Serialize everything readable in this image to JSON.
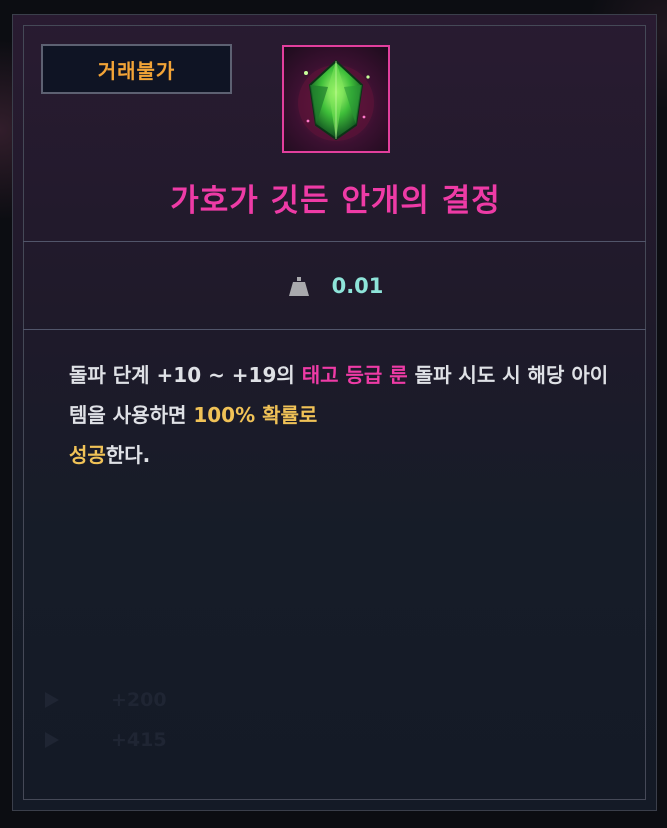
{
  "tooltip": {
    "trade_badge": "거래불가",
    "item_title": "가호가 깃든 안개의 결정",
    "weight": {
      "icon": "weight-icon",
      "value": "0.01"
    },
    "description": {
      "seg1": "돌파 단계 +10 ~ +19의 ",
      "seg2": "태고 등급 룬",
      "seg3": " 돌파 시도 시 해당 아이템을 사용하면 ",
      "seg4": "100% 확률로",
      "seg5": " ",
      "seg6": "성공",
      "seg7": "한다."
    },
    "background_rows": [
      {
        "icon": "play-icon",
        "value": "+200"
      },
      {
        "icon": "play-icon",
        "value": "+415"
      }
    ],
    "colors": {
      "rarity_pink": "#ee3ba6",
      "highlight_gold": "#f0c257",
      "weight_cyan": "#8ee4d9",
      "badge_orange": "#f3a437"
    }
  }
}
